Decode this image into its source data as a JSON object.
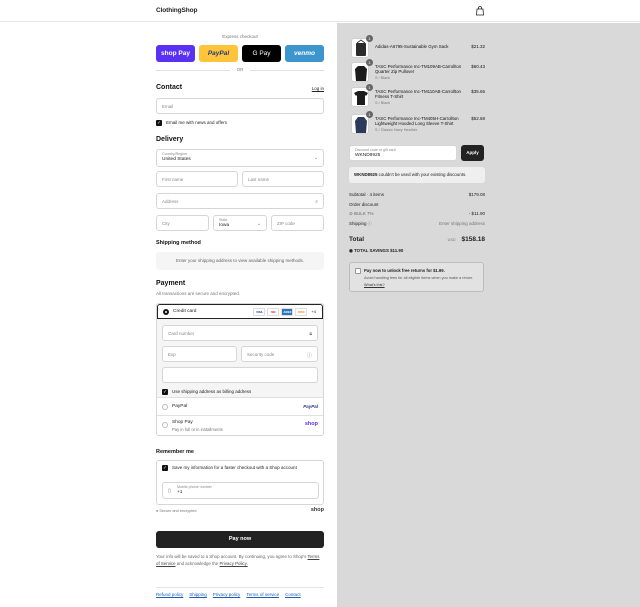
{
  "header": {
    "logo": "ClothingShop"
  },
  "express": {
    "label": "Express checkout",
    "buttons": [
      "shop Pay",
      "PayPal",
      "G Pay",
      "venmo"
    ],
    "or": "OR"
  },
  "contact": {
    "title": "Contact",
    "login": "Log in",
    "email_placeholder": "Email",
    "newsletter_label": "Email me with news and offers"
  },
  "delivery": {
    "title": "Delivery",
    "country_label": "Country/Region",
    "country_value": "United States",
    "first_name": "First name",
    "last_name": "Last name",
    "address": "Address",
    "city": "City",
    "state_label": "State",
    "state_value": "Iowa",
    "zip": "ZIP code"
  },
  "shipping": {
    "title": "Shipping method",
    "message": "Enter your shipping address to view available shipping methods."
  },
  "payment": {
    "title": "Payment",
    "subtitle": "All transactions are secure and encrypted.",
    "credit_card": "Credit card",
    "card_logos": [
      "VISA",
      "MC",
      "AMEX",
      "DISC"
    ],
    "more_cards": "+4",
    "card_number": "Card number",
    "expiry": "Exp",
    "security_code": "Security code",
    "billing_label": "Use shipping address as billing address",
    "paypal": "PayPal",
    "paypal_logo": "PayPal",
    "shoppay": "Shop Pay",
    "shoppay_sub": "Pay in full or in installments",
    "shoppay_logo": "shop"
  },
  "remember": {
    "title": "Remember me",
    "save_label": "Save my information for a faster checkout with a Shop account",
    "phone_label": "Mobile phone number",
    "phone_value": "+1",
    "secure": "Secure and encrypted",
    "shop_logo": "shop"
  },
  "pay_now": "Pay now",
  "legal": {
    "text": "Your info will be saved to a Shop account. By continuing, you agree to Shop's",
    "terms": "Terms of Service",
    "and": "and acknowledge the",
    "privacy": "Privacy Policy."
  },
  "footer": [
    "Refund policy",
    "Shipping",
    "Privacy policy",
    "Terms of service",
    "Contact"
  ],
  "summary": {
    "items": [
      {
        "qty": "1",
        "name": "Adidas-A6795-Sustainable Gym Sack",
        "variant": "",
        "price": "$21.32",
        "color": "#2b2b2b"
      },
      {
        "qty": "1",
        "name": "TASC Performance Inc-TM109AB-Carrollton Quarter Zip Pullover",
        "variant": "S / Black",
        "price": "$60.43",
        "color": "#1c1c1c"
      },
      {
        "qty": "1",
        "name": "TASC Performance Inc-TM110AB-Carrollton Fitness T-Shirt",
        "variant": "S / Black",
        "price": "$35.65",
        "color": "#1c1c1c"
      },
      {
        "qty": "1",
        "name": "TASC Performance Inc-TM405H-Carrollton Lightweight Hooded Long Sleeve T-Shirt",
        "variant": "S / Classic Navy Heather",
        "price": "$52.68",
        "color": "#2c3a5a"
      }
    ],
    "discount_label": "Discount code or gift card",
    "discount_value": "WKND8925",
    "apply": "Apply",
    "error_code": "WKND8925",
    "error_text": "couldn't be used with your existing discounts.",
    "subtotal_label": "Subtotal · 4 items",
    "subtotal_value": "$179.08",
    "order_discount": "Order discount",
    "bulk": "BULK 7%",
    "bulk_value": "- $11.90",
    "shipping_label": "Shipping",
    "shipping_value": "Enter shipping address",
    "total_label": "Total",
    "currency": "USD",
    "total_value": "$158.18",
    "savings": "TOTAL SAVINGS  $11.90",
    "returns_title": "Pay now to unlock free returns for $1.99.",
    "returns_text": "Avoid handling fees for all eligible items when you make a return.",
    "returns_link": "What's this?"
  }
}
